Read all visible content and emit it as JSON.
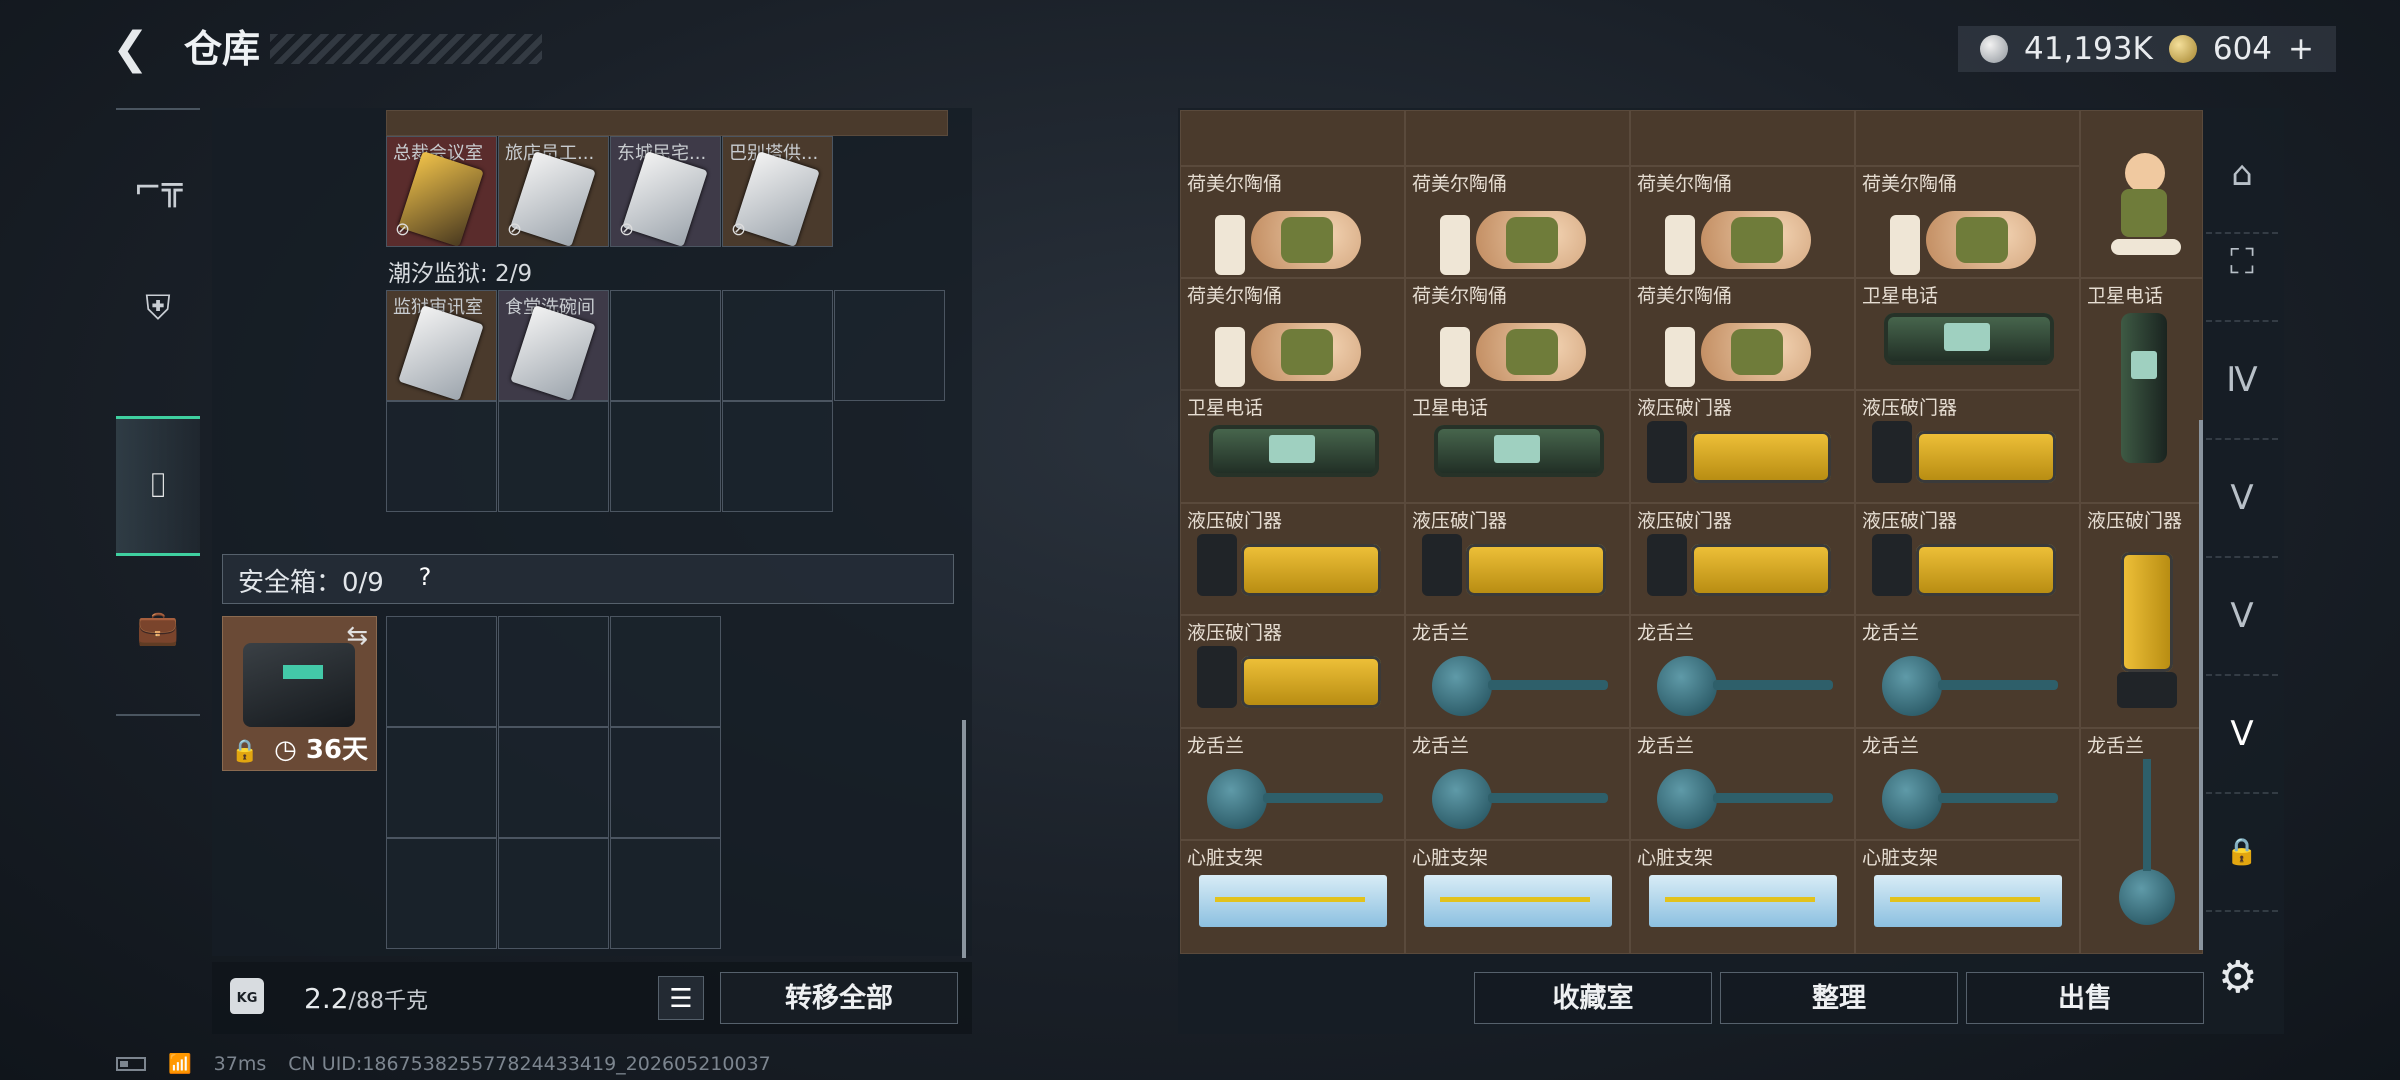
{
  "header": {
    "back": "❮",
    "title": "仓库"
  },
  "currency": {
    "silver": "41,193K",
    "gold": "604",
    "plus": "+"
  },
  "left_nav": {
    "gun_icon": "⌐╦",
    "armor_icon": "⛨",
    "bag_icon": "⌷",
    "box_icon": "💼"
  },
  "keycards_row1": [
    {
      "label": "总裁会议室"
    },
    {
      "label": "旅店员工..."
    },
    {
      "label": "东城民宅..."
    },
    {
      "label": "巴别塔供..."
    }
  ],
  "prison": {
    "label": "潮汐监狱: 2/9",
    "cards": [
      {
        "label": "监狱审讯室"
      },
      {
        "label": "食堂洗碗间"
      }
    ]
  },
  "safebox": {
    "label": "安全箱：0/9",
    "help": "?",
    "timer": "36天",
    "swap": "⇆",
    "lock": "🔒"
  },
  "weight": {
    "current": "2.2",
    "max": "/88千克",
    "kg": "KG"
  },
  "buttons": {
    "transfer_all": "转移全部",
    "list": "☰",
    "collection": "收藏室",
    "sort": "整理",
    "sell": "出售"
  },
  "items": {
    "figurine": "荷美尔陶俑",
    "phone": "卫星电话",
    "breacher": "液压破门器",
    "flower": "龙舌兰",
    "stent": "心脏支架"
  },
  "right_nav": {
    "home_icon": "⌂",
    "t1": "⛶",
    "t2": "Ⅳ",
    "t3": "V",
    "t4": "V",
    "t5": "V",
    "lock": "🔒",
    "settings": "⚙"
  },
  "footer": {
    "ping": "37ms",
    "uid": "CN UID:186753825577824433419_202605210037"
  }
}
